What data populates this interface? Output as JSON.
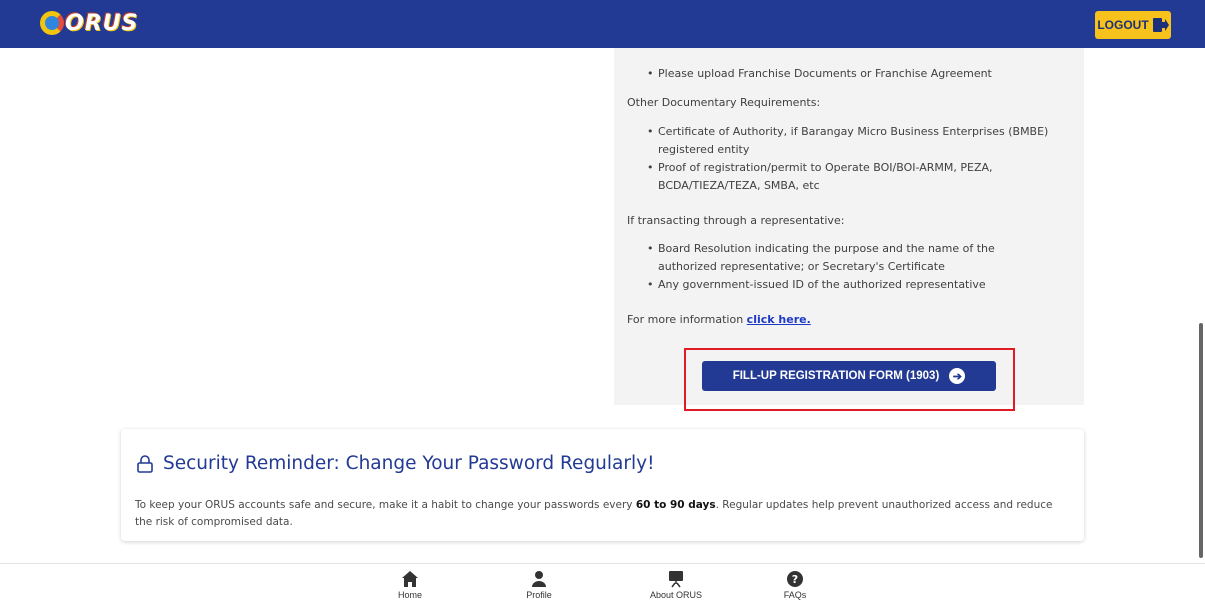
{
  "header": {
    "logo_text": "ORUS",
    "logout_label": "LOGOUT"
  },
  "requirements": {
    "franchise_item": "Please upload Franchise Documents or Franchise Agreement",
    "other_heading": "Other Documentary Requirements:",
    "other_items": [
      "Certificate of Authority, if Barangay Micro Business Enterprises (BMBE) registered entity",
      "Proof of registration/permit to Operate BOI/BOI-ARMM, PEZA, BCDA/TIEZA/TEZA, SMBA, etc"
    ],
    "rep_heading": "If transacting through a representative:",
    "rep_items": [
      "Board Resolution indicating the purpose and the name of the authorized representative; or Secretary's Certificate",
      "Any government-issued ID of the authorized representative"
    ],
    "more_info_prefix": "For more information ",
    "more_info_link": "click here.",
    "fill_button_label": "FILL-UP REGISTRATION FORM (1903)"
  },
  "security": {
    "title": "Security Reminder: Change Your Password Regularly!",
    "text_before": "To keep your ORUS accounts safe and secure, make it a habit to change your passwords every ",
    "text_bold": "60 to 90 days",
    "text_after": ". Regular updates help prevent unauthorized access and reduce the risk of compromised data."
  },
  "bottom_nav": {
    "home": "Home",
    "profile": "Profile",
    "about": "About ORUS",
    "faqs": "FAQs"
  },
  "colors": {
    "brand_blue": "#223a94",
    "logout_yellow": "#f6c21b",
    "highlight_red": "#e01b24"
  }
}
